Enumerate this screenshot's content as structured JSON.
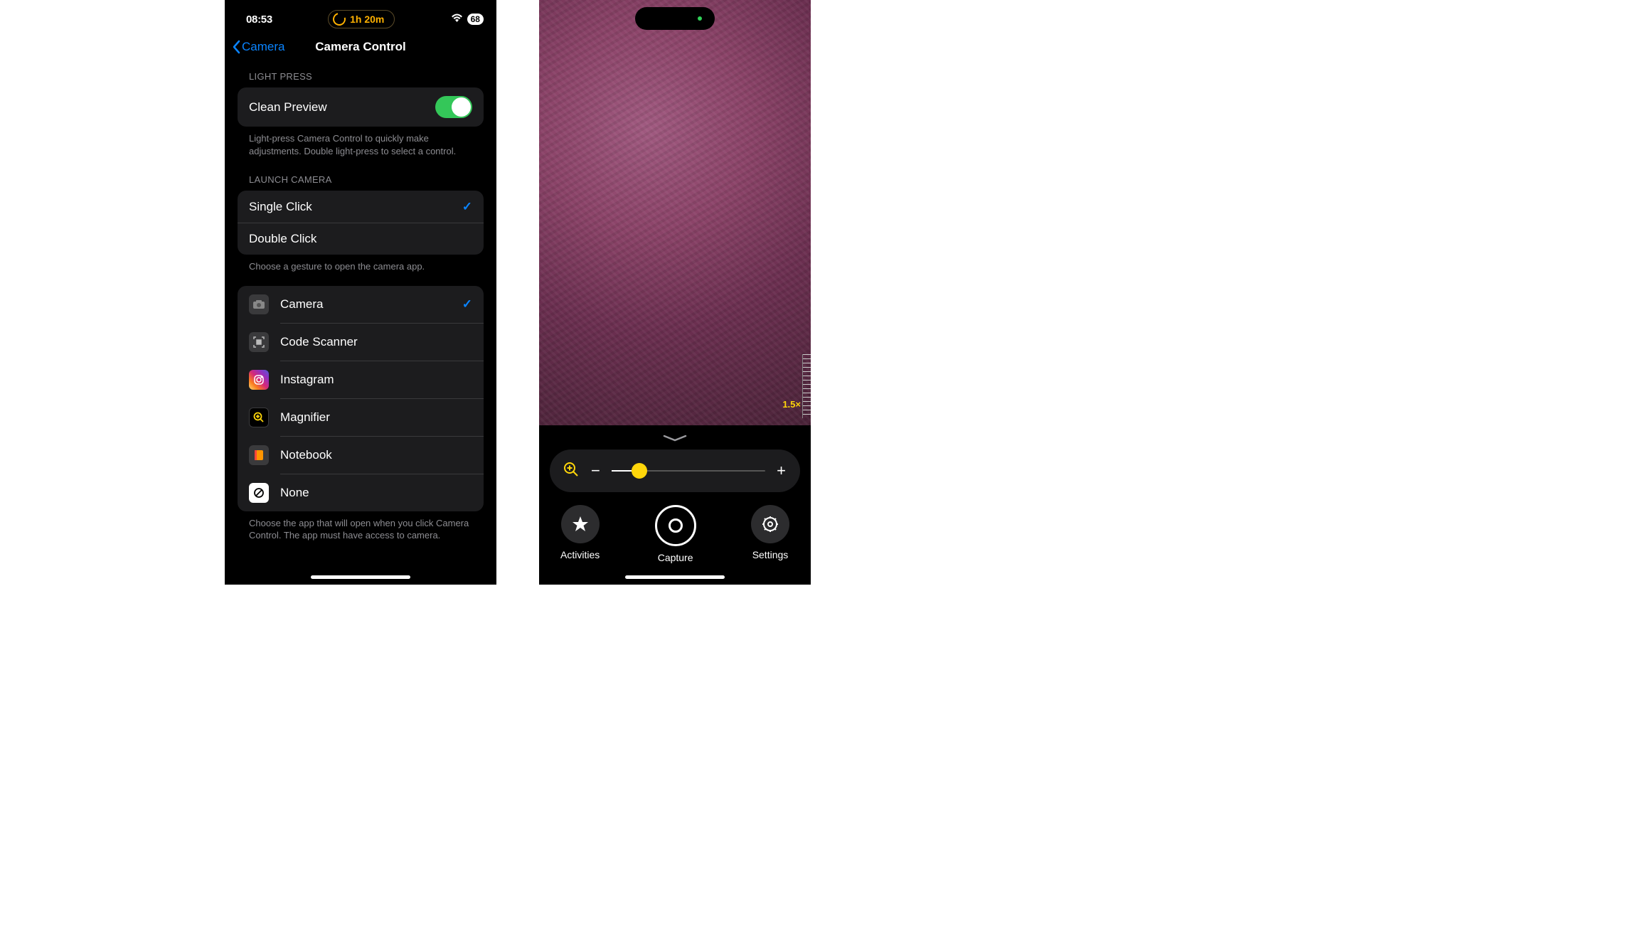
{
  "left": {
    "status": {
      "time": "08:53",
      "focus_text": "1h 20m",
      "battery": "68"
    },
    "nav": {
      "back": "Camera",
      "title": "Camera Control"
    },
    "light_press": {
      "header": "LIGHT PRESS",
      "row_label": "Clean Preview",
      "footer": "Light-press Camera Control to quickly make adjustments. Double light-press to select a control."
    },
    "launch_camera": {
      "header": "LAUNCH CAMERA",
      "options": [
        {
          "label": "Single Click",
          "selected": true
        },
        {
          "label": "Double Click",
          "selected": false
        }
      ],
      "footer": "Choose a gesture to open the camera app."
    },
    "apps": {
      "items": [
        {
          "label": "Camera",
          "selected": true,
          "icon": "camera"
        },
        {
          "label": "Code Scanner",
          "selected": false,
          "icon": "code"
        },
        {
          "label": "Instagram",
          "selected": false,
          "icon": "instagram"
        },
        {
          "label": "Magnifier",
          "selected": false,
          "icon": "magnifier"
        },
        {
          "label": "Notebook",
          "selected": false,
          "icon": "notebook"
        },
        {
          "label": "None",
          "selected": false,
          "icon": "none"
        }
      ],
      "footer": "Choose the app that will open when you click Camera Control. The app must have access to camera."
    }
  },
  "right": {
    "zoom_label": "1.5×",
    "buttons": {
      "activities": "Activities",
      "capture": "Capture",
      "settings": "Settings"
    }
  }
}
